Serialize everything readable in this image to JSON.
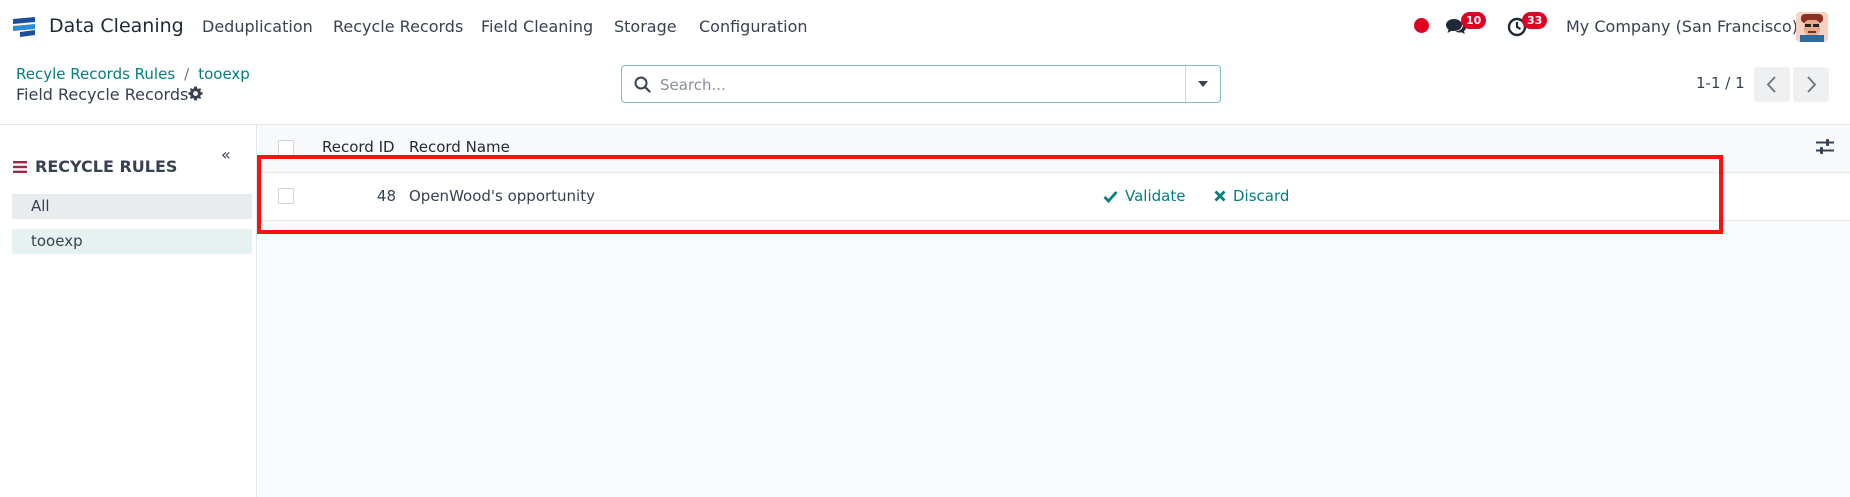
{
  "navbar": {
    "app_name": "Data Cleaning",
    "menu": [
      "Deduplication",
      "Recycle Records",
      "Field Cleaning",
      "Storage",
      "Configuration"
    ],
    "messages_count": "10",
    "activities_count": "33",
    "company": "My Company (San Francisco)"
  },
  "control_panel": {
    "breadcrumb": [
      "Recyle Records Rules",
      "tooexp"
    ],
    "title": "Field Recycle Records",
    "search_placeholder": "Search...",
    "pager": "1-1 / 1"
  },
  "sidebar": {
    "heading": "RECYCLE RULES",
    "items": [
      "All",
      "tooexp"
    ]
  },
  "list": {
    "columns": [
      "Record ID",
      "Record Name"
    ],
    "rows": [
      {
        "record_id": "48",
        "record_name": "OpenWood's opportunity"
      }
    ],
    "actions": {
      "validate": "Validate",
      "discard": "Discard"
    }
  },
  "colors": {
    "accent": "#017e84",
    "badge": "#e00023",
    "highlight": "#ff1010"
  }
}
